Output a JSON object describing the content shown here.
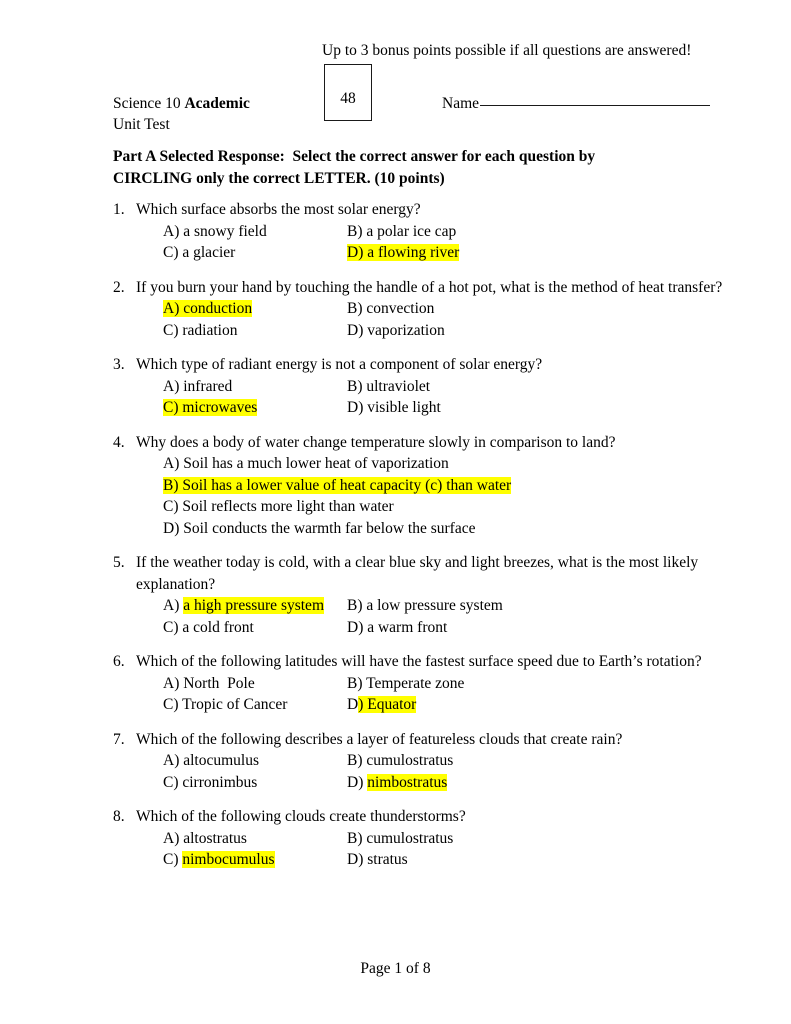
{
  "document": {
    "bonus_note": "Up to 3 bonus points possible if all questions are answered!",
    "score_value": "48",
    "course_line_1_regular": "Science 10 ",
    "course_line_1_bold": "Academic",
    "course_line_2": "Unit Test",
    "name_label": "Name",
    "instructions_line_1": "Part A Selected Response:  Select the correct answer for each question by",
    "instructions_line_2": "CIRCLING only the correct LETTER. (10 points)",
    "footer": "Page 1 of 8",
    "highlight_color": "#ffff00"
  },
  "questions": [
    {
      "number": "1.",
      "text": "Which surface absorbs the most solar energy?",
      "options": [
        {
          "label": "A) a snowy field",
          "highlight": "none"
        },
        {
          "label": "B) a polar ice cap",
          "highlight": "none"
        },
        {
          "label": "C) a glacier",
          "highlight": "none"
        },
        {
          "label": "D) a flowing river",
          "highlight": "full"
        }
      ]
    },
    {
      "number": "2.",
      "text": "If you burn your hand by touching the handle of a hot pot, what is the method of heat transfer?",
      "options": [
        {
          "label": "A) conduction",
          "highlight": "full"
        },
        {
          "label": "B) convection",
          "highlight": "none"
        },
        {
          "label": "C) radiation",
          "highlight": "none"
        },
        {
          "label": "D) vaporization",
          "highlight": "none"
        }
      ]
    },
    {
      "number": "3.",
      "text": "Which type of radiant energy is not a component of solar energy?",
      "options": [
        {
          "label": "A) infrared",
          "highlight": "none"
        },
        {
          "label": "B) ultraviolet",
          "highlight": "none"
        },
        {
          "label": "C) microwaves",
          "highlight": "full"
        },
        {
          "label": "D) visible light",
          "highlight": "none"
        }
      ]
    },
    {
      "number": "4.",
      "text": "Why does a body of water change temperature slowly in comparison to land?",
      "stacked": true,
      "options": [
        {
          "label": "A) Soil has a much lower heat of vaporization",
          "highlight": "none"
        },
        {
          "label": "B) Soil has a lower value of heat capacity (c) than water",
          "highlight": "full"
        },
        {
          "label": "C) Soil reflects more light than water",
          "highlight": "none"
        },
        {
          "label": "D) Soil conducts the warmth far below the surface",
          "highlight": "none"
        }
      ]
    },
    {
      "number": "5.",
      "text": "If the weather today is cold, with a clear blue sky and light breezes, what is the most likely explanation?",
      "options": [
        {
          "label": "A) a high pressure system",
          "highlight": "partial",
          "plain_prefix": "A) ",
          "highlight_text": "a high pressure system"
        },
        {
          "label": "B) a low pressure system",
          "highlight": "none"
        },
        {
          "label": "C) a cold front",
          "highlight": "none"
        },
        {
          "label": "D) a warm front",
          "highlight": "none"
        }
      ]
    },
    {
      "number": "6.",
      "text": "Which of the following latitudes will have the fastest surface speed due to Earth’s rotation?",
      "options": [
        {
          "label": "A) North  Pole",
          "highlight": "none"
        },
        {
          "label": "B) Temperate zone",
          "highlight": "none"
        },
        {
          "label": "C) Tropic of Cancer",
          "highlight": "none"
        },
        {
          "label": "D) Equator",
          "highlight": "partial",
          "plain_prefix": "D",
          "highlight_text": ") Equator"
        }
      ]
    },
    {
      "number": "7.",
      "text": "Which of the following describes a layer of featureless clouds that create rain?",
      "options": [
        {
          "label": "A) altocumulus",
          "highlight": "none"
        },
        {
          "label": "B) cumulostratus",
          "highlight": "none"
        },
        {
          "label": "C) cirronimbus",
          "highlight": "none"
        },
        {
          "label": "D) nimbostratus",
          "highlight": "partial",
          "plain_prefix": "D) ",
          "highlight_text": "nimbostratus"
        }
      ]
    },
    {
      "number": "8.",
      "text": "Which of the following clouds create thunderstorms?",
      "options": [
        {
          "label": "A) altostratus",
          "highlight": "none"
        },
        {
          "label": "B) cumulostratus",
          "highlight": "none"
        },
        {
          "label": "C) nimbocumulus",
          "highlight": "partial",
          "plain_prefix": "C) ",
          "highlight_text": "nimbocumulus"
        },
        {
          "label": "D) stratus",
          "highlight": "none"
        }
      ]
    }
  ]
}
